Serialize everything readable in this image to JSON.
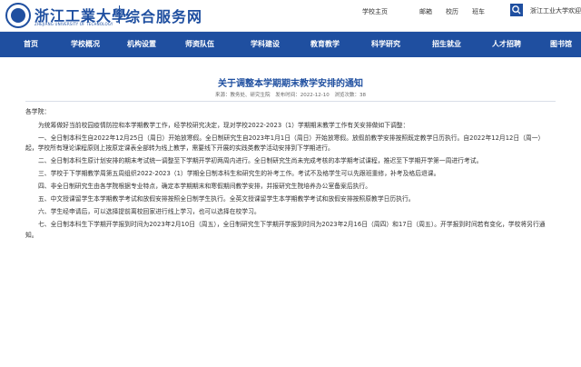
{
  "header": {
    "school_name": "浙江工業大學",
    "school_name_en": "ZHEJIANG UNIVERSITY OF TECHNOLOGY",
    "site_title": "综合服务网",
    "top_links": [
      "学校主页",
      "邮箱",
      "校历",
      "班车"
    ],
    "welcome": "浙江工业大学欢迎您!",
    "search_icon": "search-icon",
    "brand_color": "#1f4fa0"
  },
  "nav": [
    "首页",
    "学校概况",
    "机构设置",
    "师资队伍",
    "学科建设",
    "教育教学",
    "科学研究",
    "招生就业",
    "人才招聘",
    "图书馆"
  ],
  "article": {
    "title": "关于调整本学期期末教学安排的通知",
    "meta": {
      "source": "来源：教务处、研究生院",
      "date": "发布时间：2022-12-10",
      "views": "浏览次数：38"
    },
    "greeting": "各学院：",
    "paragraphs": [
      "为统筹做好当前校园疫情防控和本学期教学工作，经学校研究决定，现对学校2022-2023（1）学期期末教学工作有关安排做如下调整：",
      "一、全日制本科生自2022年12月25日（周日）开始放寒假。全日制研究生自2023年1月1日（周日）开始放寒假。放假前教学安排按照既定教学日历执行。自2022年12月12日（周一）起，学校所有理论课程原则上按原定课表全部转为线上教学，需要线下开展的实践类教学活动安排到下学期进行。",
      "二、全日制本科生原计划安排的期末考试统一调整至下学期开学初两周内进行。全日制研究生尚未完成考核的本学期考试课程，推迟至下学期开学第一周进行考试。",
      "三、学校于下学期教学周第五周组织2022-2023（1）学期全日制本科生和研究生的补考工作。考试不及格学生可以先跟班重修，补考及格后退课。",
      "四、非全日制研究生由各学院根据专业特点，确定本学期期末和寒假期间教学安排，并报研究生院培养办公室备案后执行。",
      "五、中文授课留学生本学期教学考试和放假安排按照全日制学生执行。全英文授课留学生本学期教学考试和放假安排按照原教学日历执行。",
      "六、学生经申请后，可以选择提前离校回家进行线上学习，也可以选择在校学习。",
      "七、全日制本科生下学期开学报到时间为2023年2月10日（周五），全日制研究生下学期开学报到时间为2023年2月16日（周四）和17日（周五）。开学报到时间若有变化，学校将另行通知。"
    ]
  }
}
